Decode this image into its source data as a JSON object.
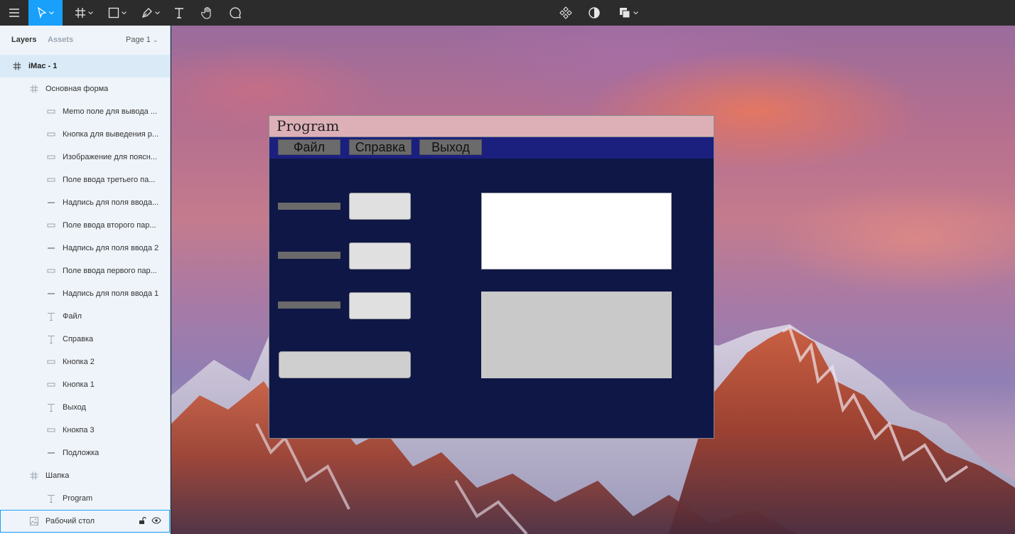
{
  "toolbar": {
    "icons": [
      "menu-icon",
      "move-tool-icon",
      "frame-tool-icon",
      "shape-tool-icon",
      "pen-tool-icon",
      "text-tool-icon",
      "hand-tool-icon",
      "comment-tool-icon",
      "component-icon",
      "mask-icon",
      "boolean-icon"
    ]
  },
  "panel": {
    "tab_layers": "Layers",
    "tab_assets": "Assets",
    "page": "Page 1",
    "layers": [
      {
        "name": "iMac - 1",
        "type": "frame",
        "indent": 0
      },
      {
        "name": "Основная форма",
        "type": "frame",
        "indent": 1
      },
      {
        "name": "Memo поле для вывода ...",
        "type": "rect",
        "indent": 2
      },
      {
        "name": "Кнопка для выведения р...",
        "type": "rect",
        "indent": 2
      },
      {
        "name": "Изображение для поясн...",
        "type": "rect",
        "indent": 2
      },
      {
        "name": "Поле ввода третьего па...",
        "type": "rect",
        "indent": 2
      },
      {
        "name": "Надпись для поля ввода...",
        "type": "line",
        "indent": 2
      },
      {
        "name": "Поле ввода второго пар...",
        "type": "rect",
        "indent": 2
      },
      {
        "name": "Надпись для поля ввода 2",
        "type": "line",
        "indent": 2
      },
      {
        "name": "Поле ввода первого пар...",
        "type": "rect",
        "indent": 2
      },
      {
        "name": "Надпись для поля ввода 1",
        "type": "line",
        "indent": 2
      },
      {
        "name": "Файл",
        "type": "text",
        "indent": 2
      },
      {
        "name": "Справка",
        "type": "text",
        "indent": 2
      },
      {
        "name": "Кнопка 2",
        "type": "rect",
        "indent": 2
      },
      {
        "name": "Кнопка 1",
        "type": "rect",
        "indent": 2
      },
      {
        "name": "Выход",
        "type": "text",
        "indent": 2
      },
      {
        "name": "Кнокпа 3",
        "type": "rect",
        "indent": 2
      },
      {
        "name": "Подложка",
        "type": "line",
        "indent": 2
      },
      {
        "name": "Шапка",
        "type": "frame",
        "indent": 1
      },
      {
        "name": "Program",
        "type": "text",
        "indent": 2
      },
      {
        "name": "Рабочий стол",
        "type": "image",
        "indent": 1
      }
    ]
  },
  "app": {
    "title": "Program",
    "menu": [
      "Файл",
      "Справка",
      "Выход"
    ]
  },
  "colors": {
    "accent": "#18a0fb",
    "app_header": "#ddb0b8",
    "app_menu": "#1b207f",
    "app_body": "#0f1746"
  }
}
